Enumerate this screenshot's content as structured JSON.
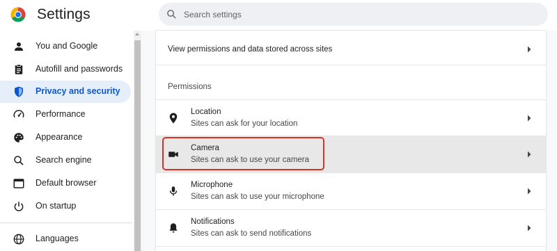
{
  "app": {
    "title": "Settings",
    "logo_icon": "chrome-logo-icon"
  },
  "search": {
    "placeholder": "Search settings",
    "icon": "search-icon"
  },
  "sidebar": {
    "items": [
      {
        "label": "You and Google",
        "icon": "person-icon",
        "active": false
      },
      {
        "label": "Autofill and passwords",
        "icon": "clipboard-icon",
        "active": false
      },
      {
        "label": "Privacy and security",
        "icon": "shield-icon",
        "active": true
      },
      {
        "label": "Performance",
        "icon": "speedometer-icon",
        "active": false
      },
      {
        "label": "Appearance",
        "icon": "palette-icon",
        "active": false
      },
      {
        "label": "Search engine",
        "icon": "search-icon",
        "active": false
      },
      {
        "label": "Default browser",
        "icon": "browser-window-icon",
        "active": false
      },
      {
        "label": "On startup",
        "icon": "power-icon",
        "active": false
      },
      {
        "label": "Languages",
        "icon": "globe-icon",
        "active": false
      }
    ]
  },
  "main": {
    "top_row": {
      "title": "View permissions and data stored across sites",
      "icon": "chevron-right-icon"
    },
    "permissions_header": "Permissions",
    "permissions": [
      {
        "title": "Location",
        "subtitle": "Sites can ask for your location",
        "icon": "location-pin-icon",
        "highlighted": false
      },
      {
        "title": "Camera",
        "subtitle": "Sites can ask to use your camera",
        "icon": "camera-icon",
        "highlighted": true
      },
      {
        "title": "Microphone",
        "subtitle": "Sites can ask to use your microphone",
        "icon": "microphone-icon",
        "highlighted": false
      },
      {
        "title": "Notifications",
        "subtitle": "Sites can ask to send notifications",
        "icon": "bell-icon",
        "highlighted": false
      }
    ]
  },
  "colors": {
    "accent": "#0b57d0",
    "active_nav_bg": "#e6eef9",
    "highlight_row_bg": "#e8e8e9",
    "annotation_red": "#d93025"
  }
}
